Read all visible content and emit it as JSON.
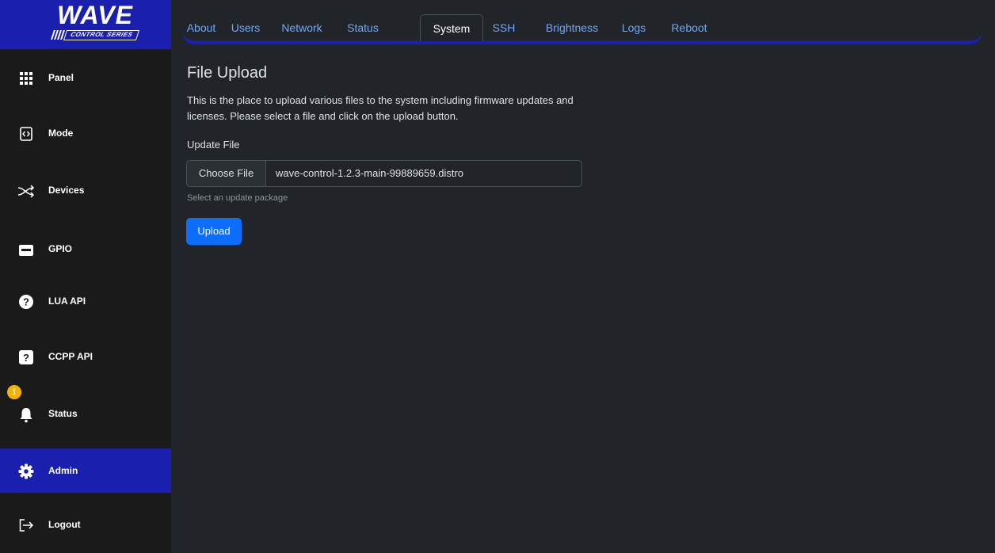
{
  "logo": {
    "title": "WAVE",
    "subtitle": "CONTROL SERIES"
  },
  "sidebar": {
    "items": [
      {
        "label": "Panel",
        "icon": "grid-icon"
      },
      {
        "label": "Mode",
        "icon": "code-icon"
      },
      {
        "label": "Devices",
        "icon": "shuffle-icon"
      },
      {
        "label": "GPIO",
        "icon": "gpio-icon"
      },
      {
        "label": "LUA API",
        "icon": "question-circle-icon"
      },
      {
        "label": "CCPP API",
        "icon": "question-square-icon"
      },
      {
        "label": "Status",
        "icon": "bell-icon",
        "badge": "1"
      },
      {
        "label": "Admin",
        "icon": "gear-icon",
        "active": true
      },
      {
        "label": "Logout",
        "icon": "logout-icon"
      }
    ]
  },
  "tabs": [
    {
      "label": "About"
    },
    {
      "label": "Users"
    },
    {
      "label": "Network"
    },
    {
      "label": "Status"
    },
    {
      "label": "System",
      "active": true
    },
    {
      "label": "SSH"
    },
    {
      "label": "Brightness"
    },
    {
      "label": "Logs"
    },
    {
      "label": "Reboot"
    }
  ],
  "main": {
    "title": "File Upload",
    "description": "This is the place to upload various files to the system including firmware updates and licenses. Please select a file and click on the upload button.",
    "field_label": "Update File",
    "choose_label": "Choose File",
    "file_name": "wave-control-1.2.3-main-99889659.distro",
    "help_text": "Select an update package",
    "upload_label": "Upload"
  },
  "colors": {
    "accent": "#1b1fae",
    "link": "#6ea8fe",
    "primary_button": "#0d6efd",
    "badge": "#f5b301",
    "background": "#212529",
    "sidebar": "#1a1a1a"
  }
}
